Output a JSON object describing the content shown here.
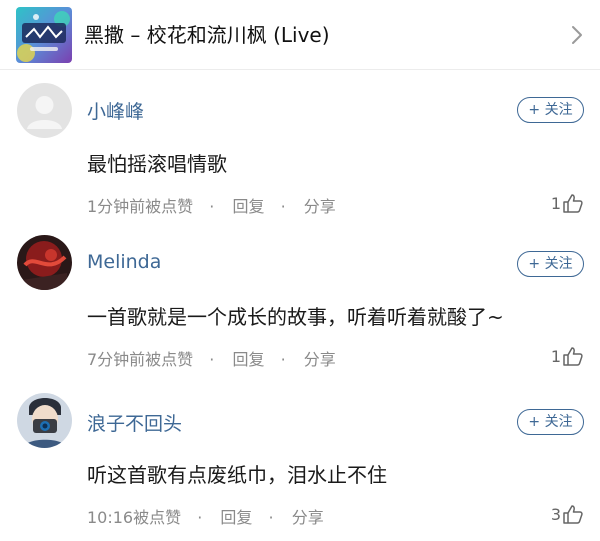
{
  "song": {
    "title": "黑撒 – 校花和流川枫 (Live)",
    "cover_icon": "album-cover",
    "open_icon": "chevron-right-icon"
  },
  "follow_label": "+ 关注",
  "meta_separator": "·",
  "comments": [
    {
      "username": "小峰峰",
      "avatar": "default-avatar",
      "text": "最怕摇滚唱情歌",
      "time": "1分钟前被点赞",
      "reply_label": "回复",
      "share_label": "分享",
      "likes": "1"
    },
    {
      "username": "Melinda",
      "avatar": "red-photo-avatar",
      "text": "一首歌就是一个成长的故事，听着听着就酸了~",
      "time": "7分钟前被点赞",
      "reply_label": "回复",
      "share_label": "分享",
      "likes": "1"
    },
    {
      "username": "浪子不回头",
      "avatar": "camera-photo-avatar",
      "text": "听这首歌有点废纸巾，泪水止不住",
      "time": "10:16被点赞",
      "reply_label": "回复",
      "share_label": "分享",
      "likes": "3"
    }
  ],
  "colors": {
    "link_blue": "#3e6895",
    "meta_gray": "#8a8a8a",
    "divider": "#ececec"
  }
}
